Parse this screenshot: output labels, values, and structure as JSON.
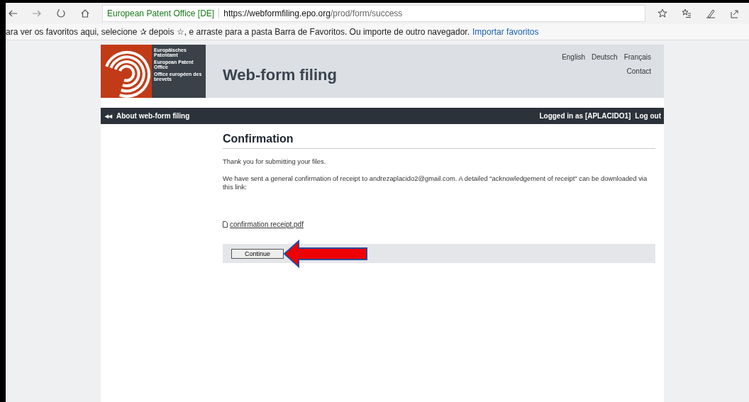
{
  "browser": {
    "site_identity": "European Patent Office [DE]",
    "url_host": "https://webformfiling.epo.org",
    "url_path": "/prod/form/success"
  },
  "favorites_bar": {
    "message": "ara ver os favoritos aqui, selecione ✰ depois ☆, e arraste para a pasta Barra de Favoritos. Ou importe de outro navegador.",
    "link": "Importar favoritos"
  },
  "logo": {
    "lines": [
      "Europäisches Patentamt",
      "European Patent Office",
      "Office européen des brevets"
    ]
  },
  "header": {
    "title": "Web-form filing",
    "languages": [
      "English",
      "Deutsch",
      "Français"
    ],
    "contact": "Contact"
  },
  "nav": {
    "back_icon": "◂◂",
    "back_link": "About web-form filing",
    "logged_in": "Logged in as [APLACIDO1]",
    "logout": "Log out"
  },
  "content": {
    "heading": "Confirmation",
    "paragraphs": [
      "Thank you for submitting your files.",
      "We have sent a general confirmation of receipt to andrezaplacido2@gmail.com. A detailed \"acknowledgement of receipt\" can be downloaded via this link:"
    ],
    "file_link": "confirmation receipt.pdf",
    "button": "Continue"
  }
}
